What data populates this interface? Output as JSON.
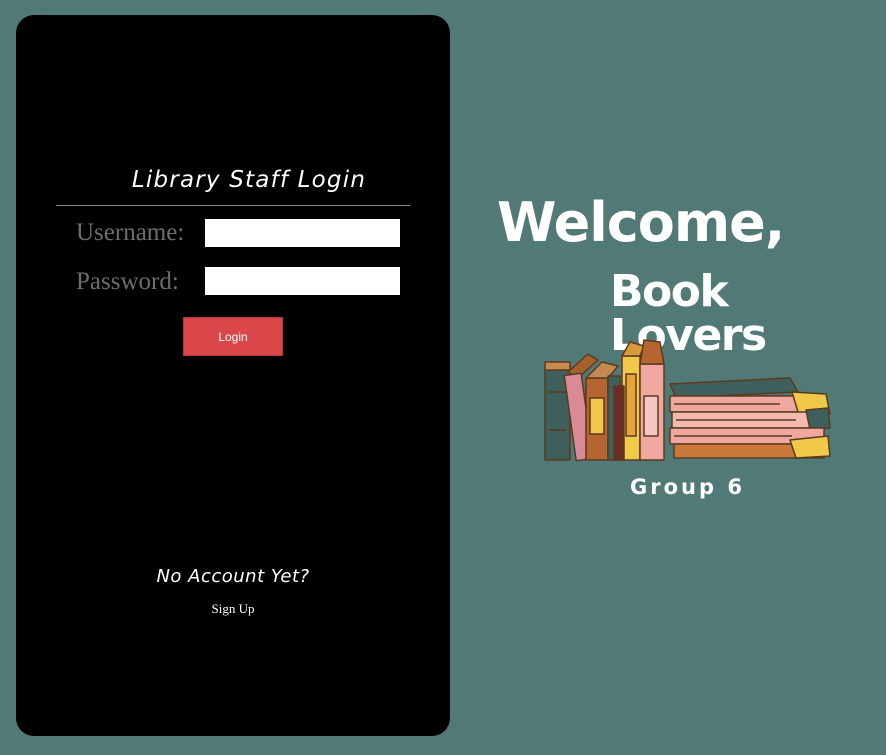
{
  "login_panel": {
    "title": "Library Staff Login",
    "username_label": "Username:",
    "username_value": "",
    "password_label": "Password:",
    "password_value": "",
    "login_button_label": "Login",
    "no_account_text": "No Account Yet?",
    "signup_link_label": "Sign Up"
  },
  "welcome": {
    "line1": "Welcome,",
    "line2": "Book Lovers",
    "group_label": "Group 6",
    "illustration": "stack-of-books-illustration"
  },
  "colors": {
    "background": "#517a77",
    "panel": "#000000",
    "login_button": "#d9474b",
    "label_text": "#6d6d6d",
    "text": "#ffffff"
  }
}
